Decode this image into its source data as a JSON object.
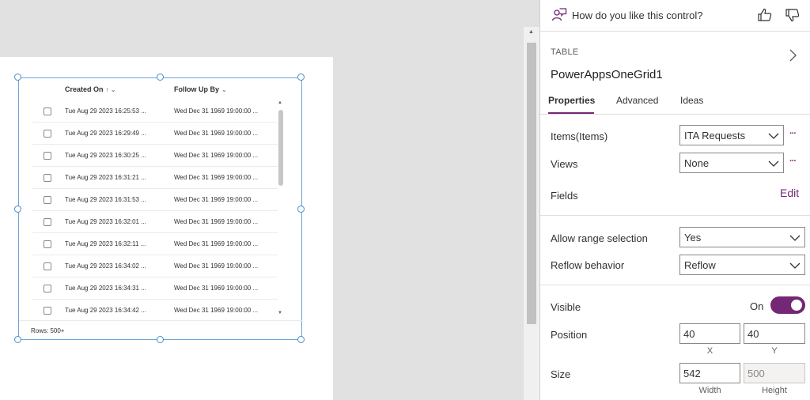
{
  "grid": {
    "columns": [
      {
        "label": "Created On",
        "glyph": "↑ ⌄"
      },
      {
        "label": "Follow Up By",
        "glyph": "⌄"
      }
    ],
    "rows": [
      {
        "created": "Tue Aug 29 2023 16:25:53 ...",
        "follow": "Wed Dec 31 1969 19:00:00 ..."
      },
      {
        "created": "Tue Aug 29 2023 16:29:49 ...",
        "follow": "Wed Dec 31 1969 19:00:00 ..."
      },
      {
        "created": "Tue Aug 29 2023 16:30:25 ...",
        "follow": "Wed Dec 31 1969 19:00:00 ..."
      },
      {
        "created": "Tue Aug 29 2023 16:31:21 ...",
        "follow": "Wed Dec 31 1969 19:00:00 ..."
      },
      {
        "created": "Tue Aug 29 2023 16:31:53 ...",
        "follow": "Wed Dec 31 1969 19:00:00 ..."
      },
      {
        "created": "Tue Aug 29 2023 16:32:01 ...",
        "follow": "Wed Dec 31 1969 19:00:00 ..."
      },
      {
        "created": "Tue Aug 29 2023 16:32:11 ...",
        "follow": "Wed Dec 31 1969 19:00:00 ..."
      },
      {
        "created": "Tue Aug 29 2023 16:34:02 ...",
        "follow": "Wed Dec 31 1969 19:00:00 ..."
      },
      {
        "created": "Tue Aug 29 2023 16:34:31 ...",
        "follow": "Wed Dec 31 1969 19:00:00 ..."
      },
      {
        "created": "Tue Aug 29 2023 16:34:42 ...",
        "follow": "Wed Dec 31 1969 19:00:00 ..."
      }
    ],
    "footer": "Rows: 500+"
  },
  "panel": {
    "feedback": {
      "question": "How do you like this control?",
      "icons": [
        "feedback-icon",
        "thumbs-up-icon",
        "thumbs-down-icon"
      ]
    },
    "control_type": "TABLE",
    "control_name": "PowerAppsOneGrid1",
    "tabs": [
      "Properties",
      "Advanced",
      "Ideas"
    ],
    "active_tab": "Properties",
    "items": {
      "label": "Items(Items)",
      "value": "ITA Requests"
    },
    "views": {
      "label": "Views",
      "value": "None"
    },
    "fields": {
      "label": "Fields",
      "action": "Edit"
    },
    "more": "···",
    "allow_range": {
      "label": "Allow range selection",
      "value": "Yes"
    },
    "reflow": {
      "label": "Reflow behavior",
      "value": "Reflow"
    },
    "visible": {
      "label": "Visible",
      "state": "On",
      "on": true
    },
    "position": {
      "label": "Position",
      "x": "40",
      "y": "40",
      "x_label": "X",
      "y_label": "Y"
    },
    "size": {
      "label": "Size",
      "width": "542",
      "height": "500",
      "width_label": "Width",
      "height_label": "Height"
    }
  },
  "colors": {
    "accent": "#742774",
    "selection": "#4a8dcc"
  }
}
